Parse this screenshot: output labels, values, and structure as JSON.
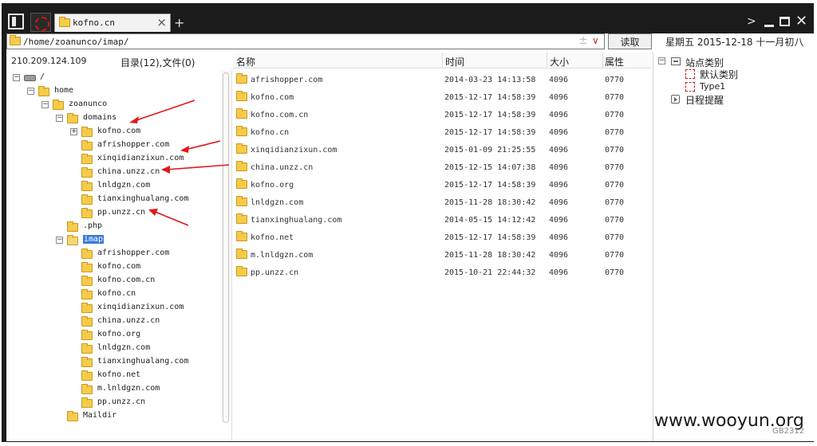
{
  "window": {
    "tab_label": "kofno.cn",
    "new_tab": "+",
    "close_tab": "×"
  },
  "toolbar": {
    "address": "/home/zoanunco/imap/",
    "read_button": "读取",
    "plus": "±",
    "dropdown": "∨",
    "date": "星期五 2015-12-18 十一月初八"
  },
  "info": {
    "ip": "210.209.124.109",
    "dir_count": "目录(12),文件(0)"
  },
  "tree": [
    {
      "label": "/",
      "icon": "drive-icon",
      "expander": "−"
    },
    {
      "label": "home",
      "icon": "folder-icon",
      "expander": "−"
    },
    {
      "label": "zoanunco",
      "icon": "folder-icon",
      "expander": "−"
    },
    {
      "label": "domains",
      "icon": "folder-icon",
      "expander": "−"
    },
    {
      "label": "kofno.com",
      "icon": "folder-icon",
      "expander": "+"
    },
    {
      "label": "afrishopper.com",
      "icon": "folder-icon"
    },
    {
      "label": "xinqidianzixun.com",
      "icon": "folder-icon"
    },
    {
      "label": "china.unzz.cn",
      "icon": "folder-icon"
    },
    {
      "label": "lnldgzn.com",
      "icon": "folder-icon"
    },
    {
      "label": "tianxinghualang.com",
      "icon": "folder-icon"
    },
    {
      "label": "pp.unzz.cn",
      "icon": "folder-icon"
    },
    {
      "label": ".php",
      "icon": "folder-icon"
    },
    {
      "label": "imap",
      "icon": "folder-icon",
      "expander": "−",
      "selected": true
    },
    {
      "label": "afrishopper.com",
      "icon": "folder-icon"
    },
    {
      "label": "kofno.com",
      "icon": "folder-icon"
    },
    {
      "label": "kofno.com.cn",
      "icon": "folder-icon"
    },
    {
      "label": "kofno.cn",
      "icon": "folder-icon"
    },
    {
      "label": "xinqidianzixun.com",
      "icon": "folder-icon"
    },
    {
      "label": "china.unzz.cn",
      "icon": "folder-icon"
    },
    {
      "label": "kofno.org",
      "icon": "folder-icon"
    },
    {
      "label": "lnldgzn.com",
      "icon": "folder-icon"
    },
    {
      "label": "tianxinghualang.com",
      "icon": "folder-icon"
    },
    {
      "label": "kofno.net",
      "icon": "folder-icon"
    },
    {
      "label": "m.lnldgzn.com",
      "icon": "folder-icon"
    },
    {
      "label": "pp.unzz.cn",
      "icon": "folder-icon"
    },
    {
      "label": "Maildir",
      "icon": "folder-icon"
    }
  ],
  "list": {
    "headers": {
      "name": "名称",
      "time": "时间",
      "size": "大小",
      "perm": "属性"
    },
    "rows": [
      {
        "name": "afrishopper.com",
        "time": "2014-03-23 14:13:58",
        "size": "4096",
        "perm": "0770"
      },
      {
        "name": "kofno.com",
        "time": "2015-12-17 14:58:39",
        "size": "4096",
        "perm": "0770"
      },
      {
        "name": "kofno.com.cn",
        "time": "2015-12-17 14:58:39",
        "size": "4096",
        "perm": "0770"
      },
      {
        "name": "kofno.cn",
        "time": "2015-12-17 14:58:39",
        "size": "4096",
        "perm": "0770"
      },
      {
        "name": "xinqidianzixun.com",
        "time": "2015-01-09 21:25:55",
        "size": "4096",
        "perm": "0770"
      },
      {
        "name": "china.unzz.cn",
        "time": "2015-12-15 14:07:38",
        "size": "4096",
        "perm": "0770"
      },
      {
        "name": "kofno.org",
        "time": "2015-12-17 14:58:39",
        "size": "4096",
        "perm": "0770"
      },
      {
        "name": "lnldgzn.com",
        "time": "2015-11-28 18:30:42",
        "size": "4096",
        "perm": "0770"
      },
      {
        "name": "tianxinghualang.com",
        "time": "2014-05-15 14:12:42",
        "size": "4096",
        "perm": "0770"
      },
      {
        "name": "kofno.net",
        "time": "2015-12-17 14:58:39",
        "size": "4096",
        "perm": "0770"
      },
      {
        "name": "m.lnldgzn.com",
        "time": "2015-11-28 18:30:42",
        "size": "4096",
        "perm": "0770"
      },
      {
        "name": "pp.unzz.cn",
        "time": "2015-10-21 22:44:32",
        "size": "4096",
        "perm": "0770"
      }
    ]
  },
  "right_panel": {
    "site_category": "站点类别",
    "default_category": "默认类别",
    "type1": "Type1",
    "schedule": "日程提醒"
  },
  "footer": {
    "watermark": "www.wooyun.org",
    "encoding": "GB2312"
  },
  "colors": {
    "titlebar": "#1b1b1b",
    "selected": "#3a7ad6",
    "arrow": "#e01818",
    "folder": "#f6cb4a"
  }
}
